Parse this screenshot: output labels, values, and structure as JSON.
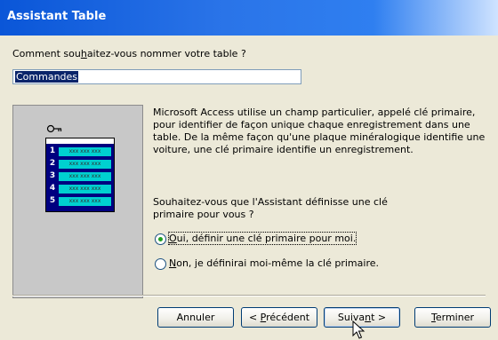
{
  "window": {
    "title": "Assistant Table"
  },
  "form": {
    "question_before": "Comment sou",
    "question_mnemonic": "h",
    "question_after": "aitez-vous nommer votre table ?",
    "table_name_value": "Commandes"
  },
  "illustration": {
    "rows": [
      {
        "num": "1",
        "cells": "xxx xxx xxx"
      },
      {
        "num": "2",
        "cells": "xxx xxx xxx"
      },
      {
        "num": "3",
        "cells": "xxx xxx xxx"
      },
      {
        "num": "4",
        "cells": "xxx xxx xxx"
      },
      {
        "num": "5",
        "cells": "xxx xxx xxx"
      }
    ]
  },
  "description": {
    "line1": "Microsoft Access utilise un champ particulier, appelé clé primaire,",
    "line2": "pour identifier de façon unique chaque enregistrement dans une",
    "line3": "table. De la même façon qu'une plaque minéralogique identifie une",
    "line4": "voiture, une clé primaire identifie un enregistrement."
  },
  "prompt": {
    "line1": "Souhaitez-vous que l'Assistant définisse une clé",
    "line2": "primaire pour vous ?"
  },
  "options": {
    "yes_mnemonic": "O",
    "yes_rest": "ui, définir une clé primaire pour moi.",
    "no_mnemonic": "N",
    "no_rest": "on, je définirai moi-même la clé primaire.",
    "selected": "yes"
  },
  "buttons": {
    "cancel": "Annuler",
    "back_prefix": "< ",
    "back_mnemonic": "P",
    "back_rest": "récédent",
    "next_prefix": "Suiva",
    "next_mnemonic": "n",
    "next_rest": "t >",
    "finish_mnemonic": "T",
    "finish_rest": "erminer"
  }
}
